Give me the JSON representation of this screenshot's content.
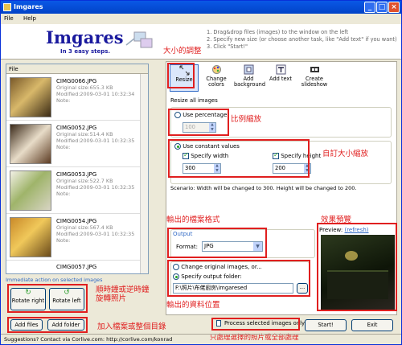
{
  "window": {
    "title": "Imgares"
  },
  "menu": [
    "File",
    "Help"
  ],
  "header": {
    "logo": "Imgares",
    "tagline": "In 3 easy steps.",
    "step1": "1. Drag&drop files (images) to the window on the left",
    "step2": "2. Specify new size (or choose another task, like \"Add text\" if you want)",
    "step3": "3. Click \"Start!\""
  },
  "file_list": {
    "header": "File",
    "items": [
      {
        "name": "CIMG0066.JPG",
        "size": "Original size:655.3 KB",
        "modified": "Modified:2009-03-01 10:32:34",
        "note": "Note:"
      },
      {
        "name": "CIMG0052.JPG",
        "size": "Original size:514.4 KB",
        "modified": "Modified:2009-03-01 10:32:35",
        "note": "Note:"
      },
      {
        "name": "CIMG0053.JPG",
        "size": "Original size:522.7 KB",
        "modified": "Modified:2009-03-01 10:32:35",
        "note": "Note:"
      },
      {
        "name": "CIMG0054.JPG",
        "size": "Original size:567.4 KB",
        "modified": "Modified:2009-03-01 10:32:35",
        "note": "Note:"
      },
      {
        "name": "CIMG0057.JPG",
        "size": "",
        "modified": "",
        "note": ""
      }
    ]
  },
  "immediate": "Immediate action on selected images",
  "buttons": {
    "rotate_right": "Rotate right",
    "rotate_left": "Rotate left",
    "add_files": "Add files",
    "add_folder": "Add folder",
    "process_selected": "Process selected images only",
    "start": "Start!",
    "exit": "Exit"
  },
  "toolbar": [
    {
      "label": "Resize",
      "icon": "resize-icon"
    },
    {
      "label": "Change colors",
      "icon": "palette-icon"
    },
    {
      "label": "Add background",
      "icon": "background-icon"
    },
    {
      "label": "Add text",
      "icon": "text-icon"
    },
    {
      "label": "Create slideshow",
      "icon": "film-icon"
    }
  ],
  "resize": {
    "title": "Resize all images",
    "use_percentage": "Use percentage",
    "percentage_value": "100",
    "use_constant": "Use constant values",
    "specify_width": "Specify width",
    "width_value": "300",
    "specify_height": "Specify height",
    "height_value": "200",
    "scenario": "Scenario: Width will be changed to 300. Height will be changed to 200."
  },
  "output": {
    "title": "Output",
    "format_label": "Format:",
    "format_value": "JPG",
    "change_original": "Change original images, or...",
    "specify_folder": "Specify output folder:",
    "folder_value": "F:\\照片\\布佬廚房\\imgaresed",
    "browse": "..."
  },
  "preview": {
    "label": "Preview:",
    "refresh": "(refresh)"
  },
  "annotations": {
    "resize_tool": "大小的調整",
    "percentage": "比例縮放",
    "custom_size": "自訂大小縮放",
    "format": "輸出的檔案格式",
    "preview": "效果預覽",
    "rotate": "順時鐘或逆時鐘\n旋轉照片",
    "folder": "輸出的資料位置",
    "add": "加入檔案或整個目錄",
    "process": "只處理選擇的照片或全部處理"
  },
  "status": "Suggestions? Contact via Corlive.com: http://corlive.com/konrad"
}
